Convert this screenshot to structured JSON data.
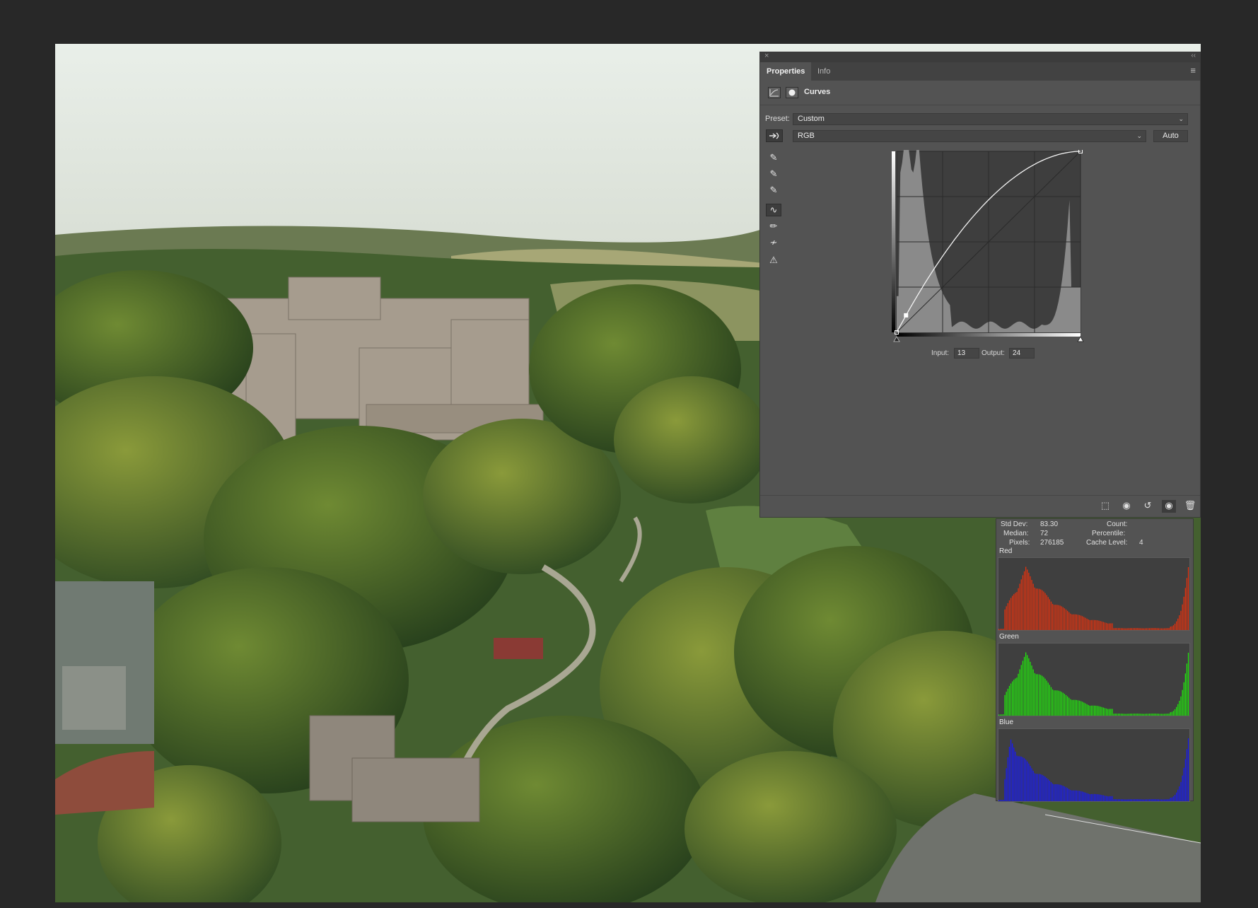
{
  "panel": {
    "tabs": [
      "Properties",
      "Info"
    ],
    "close_glyph": "×",
    "collapse_glyph": "‹‹",
    "menu_glyph": "≡",
    "title": "Curves",
    "preset_label": "Preset:",
    "preset_value": "Custom",
    "channel_value": "RGB",
    "auto_label": "Auto",
    "input_label": "Input:",
    "input_value": "13",
    "output_label": "Output:",
    "output_value": "24",
    "tools": [
      {
        "name": "sample-shadow-eyedropper-icon",
        "glyph": "✎"
      },
      {
        "name": "sample-midtone-eyedropper-icon",
        "glyph": "✎"
      },
      {
        "name": "sample-highlight-eyedropper-icon",
        "glyph": "✎"
      },
      {
        "name": "edit-points-curve-icon",
        "glyph": "∿"
      },
      {
        "name": "draw-pencil-icon",
        "glyph": "✏"
      },
      {
        "name": "smooth-curve-icon",
        "glyph": "≁"
      },
      {
        "name": "clipping-warning-icon",
        "glyph": "⚠"
      }
    ],
    "footer_icons": [
      {
        "name": "clip-to-layer-icon",
        "glyph": "⬚"
      },
      {
        "name": "view-previous-state-icon",
        "glyph": "◉"
      },
      {
        "name": "reset-icon",
        "glyph": "↺"
      },
      {
        "name": "toggle-visibility-icon",
        "glyph": "◉"
      },
      {
        "name": "delete-icon",
        "glyph": "🗑"
      }
    ],
    "curve_points": [
      [
        0,
        0
      ],
      [
        13,
        24
      ],
      [
        255,
        255
      ]
    ],
    "histogram_tone": "#8a8a8a"
  },
  "histogram": {
    "stats": {
      "std_dev_label": "Std Dev:",
      "std_dev": "83.30",
      "median_label": "Median:",
      "median": "72",
      "pixels_label": "Pixels:",
      "pixels": "276185",
      "count_label": "Count:",
      "count": "",
      "percentile_label": "Percentile:",
      "percentile": "",
      "cache_label": "Cache Level:",
      "cache": "4"
    },
    "channels": [
      {
        "name": "Red",
        "color": "#e2320f"
      },
      {
        "name": "Green",
        "color": "#22e40d"
      },
      {
        "name": "Blue",
        "color": "#1a1cf0"
      }
    ]
  }
}
